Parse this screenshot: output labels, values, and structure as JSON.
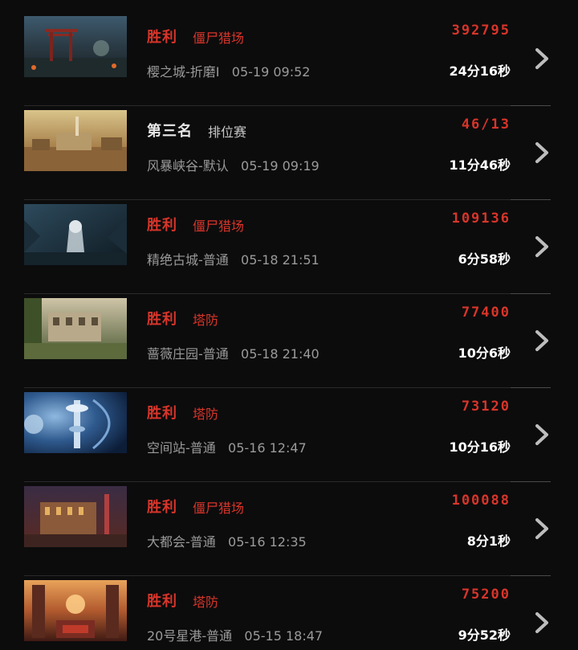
{
  "colors": {
    "win": "#d8352a",
    "mode": "#d8352a",
    "rank": "#e8e8e8",
    "rank_mode": "#c8c8c8",
    "score": "#d8352a",
    "background": "#0c0c0d"
  },
  "matches": [
    {
      "result": "胜利",
      "result_type": "win",
      "mode": "僵尸猎场",
      "map": "樱之城-折磨I",
      "datetime": "05-19 09:52",
      "score": "392795",
      "duration": "24分16秒",
      "thumb": "torii-gate-night"
    },
    {
      "result": "第三名",
      "result_type": "rank",
      "mode": "排位赛",
      "map": "风暴峡谷-默认",
      "datetime": "05-19 09:19",
      "score": "46/13",
      "duration": "11分46秒",
      "thumb": "desert-canyon"
    },
    {
      "result": "胜利",
      "result_type": "win",
      "mode": "僵尸猎场",
      "map": "精绝古城-普通",
      "datetime": "05-18 21:51",
      "score": "109136",
      "duration": "6分58秒",
      "thumb": "hooded-figure-dark"
    },
    {
      "result": "胜利",
      "result_type": "win",
      "mode": "塔防",
      "map": "蔷薇庄园-普通",
      "datetime": "05-18 21:40",
      "score": "77400",
      "duration": "10分6秒",
      "thumb": "manor-courtyard"
    },
    {
      "result": "胜利",
      "result_type": "win",
      "mode": "塔防",
      "map": "空间站-普通",
      "datetime": "05-16 12:47",
      "score": "73120",
      "duration": "10分16秒",
      "thumb": "space-station-tower"
    },
    {
      "result": "胜利",
      "result_type": "win",
      "mode": "僵尸猎场",
      "map": "大都会-普通",
      "datetime": "05-16 12:35",
      "score": "100088",
      "duration": "8分1秒",
      "thumb": "metropolis-city"
    },
    {
      "result": "胜利",
      "result_type": "win",
      "mode": "塔防",
      "map": "20号星港-普通",
      "datetime": "05-15 18:47",
      "score": "75200",
      "duration": "9分52秒",
      "thumb": "star-port-sunset"
    }
  ]
}
